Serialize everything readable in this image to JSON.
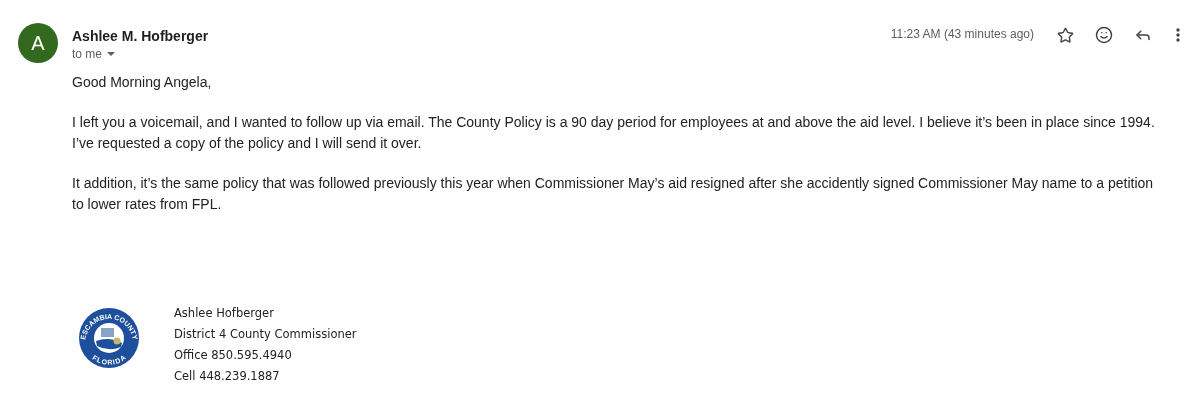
{
  "sender": {
    "initial": "A",
    "name": "Ashlee M. Hofberger",
    "recipient": "to me"
  },
  "timestamp": "11:23 AM (43 minutes ago)",
  "body": [
    "Good Morning Angela,",
    "I left you a voicemail, and I wanted to follow up via email. The County Policy is a 90 day period for employees at and above the aid level. I believe it’s been in place since 1994. I’ve requested a copy of the policy and I will send it over.",
    "It addition, it’s the same policy that was followed previously this year when Commissioner May’s aid resigned after she accidently signed Commissioner May name to a petition to lower rates from FPL."
  ],
  "signature": {
    "logo": {
      "top_text": "ESCAMBIA COUNTY",
      "bottom_text": "FLORIDA"
    },
    "lines": [
      "Ashlee Hofberger",
      "District 4 County Commissioner",
      "Office 850.595.4940",
      "Cell 448.239.1887"
    ]
  }
}
